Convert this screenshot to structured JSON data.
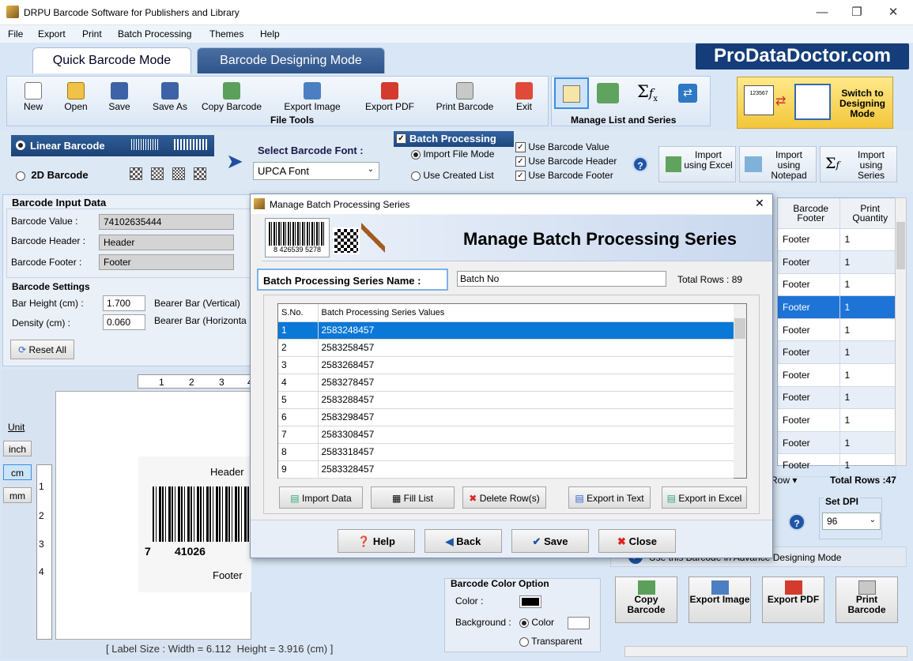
{
  "window": {
    "title": "DRPU Barcode Software for Publishers and Library",
    "min": "—",
    "max": "❐",
    "close": "✕"
  },
  "menu": [
    "File",
    "Export",
    "Print",
    "Batch Processing",
    "Themes",
    "Help"
  ],
  "tabs": {
    "quick": "Quick Barcode Mode",
    "design": "Barcode Designing Mode"
  },
  "brand": "ProDataDoctor.com",
  "tools": {
    "new": "New",
    "open": "Open",
    "save": "Save",
    "save_as": "Save As",
    "copy_barcode": "Copy Barcode",
    "export_image": "Export Image",
    "export_pdf": "Export PDF",
    "print_barcode": "Print Barcode",
    "exit": "Exit",
    "group": "File Tools"
  },
  "manage": {
    "group": "Manage List and Series"
  },
  "switch": {
    "label": "Switch to Designing Mode",
    "sample": "123567"
  },
  "barcode_type": {
    "linear": "Linear Barcode",
    "twod": "2D Barcode"
  },
  "font": {
    "label": "Select Barcode Font :",
    "value": "UPCA Font"
  },
  "batch": {
    "title": "Batch Processing",
    "import_file": "Import File Mode",
    "use_list": "Use Created List",
    "use_value": "Use Barcode Value",
    "use_header": "Use Barcode Header",
    "use_footer": "Use Barcode Footer",
    "help": "?"
  },
  "imports": {
    "excel": "Import using Excel",
    "notepad": "Import using Notepad",
    "series": "Import using Series"
  },
  "input": {
    "title": "Barcode Input Data",
    "value_label": "Barcode Value :",
    "value": "74102635444",
    "header_label": "Barcode Header :",
    "header": "Header",
    "footer_label": "Barcode Footer :",
    "footer": "Footer"
  },
  "settings": {
    "title": "Barcode Settings",
    "bar_height_label": "Bar Height (cm) :",
    "bar_height": "1.700",
    "density_label": "Density (cm) :",
    "density": "0.060",
    "bearer_v": "Bearer Bar (Vertical)",
    "bearer_h": "Bearer Bar (Horizonta",
    "reset": "Reset All"
  },
  "units": {
    "label": "Unit",
    "inch": "inch",
    "cm": "cm",
    "mm": "mm"
  },
  "ruler": [
    "1",
    "2",
    "3",
    "4"
  ],
  "vruler": [
    "1",
    "2",
    "3",
    "4"
  ],
  "preview": {
    "header": "Header",
    "footer": "Footer",
    "num_left": "7",
    "num_mid": "41026"
  },
  "status": "[ Label Size : Width = 6.112  Height = 3.916 (cm) ]",
  "color": {
    "title": "Barcode Color Option",
    "color_label": "Color :",
    "bg_label": "Background :",
    "opt_color": "Color",
    "opt_transparent": "Transparent",
    "bar_color": "#000000"
  },
  "right_table": {
    "col_footer": "Barcode Footer",
    "col_qty": "Print Quantity",
    "rows": [
      [
        "Footer",
        "1"
      ],
      [
        "Footer",
        "1"
      ],
      [
        "Footer",
        "1"
      ],
      [
        "Footer",
        "1"
      ],
      [
        "Footer",
        "1"
      ],
      [
        "Footer",
        "1"
      ],
      [
        "Footer",
        "1"
      ],
      [
        "Footer",
        "1"
      ],
      [
        "Footer",
        "1"
      ],
      [
        "Footer",
        "1"
      ],
      [
        "Footer",
        "1"
      ]
    ],
    "row_dd": "Row ▾",
    "total": "Total Rows :47"
  },
  "dpi": {
    "label": "Set DPI",
    "value": "96",
    "nt": "nt",
    "help": "?"
  },
  "advance": "Use this Barcode in Advance Designing Mode",
  "bottom_buttons": {
    "copy": "Copy Barcode",
    "image": "Export Image",
    "pdf": "Export PDF",
    "print": "Print Barcode"
  },
  "dialog": {
    "title": "Manage Batch Processing Series",
    "banner": "Manage Batch Processing Series",
    "banner_digits": "8 426539 5278",
    "series_label": "Batch Processing Series Name :",
    "series_name": "Batch No",
    "total_rows": "Total Rows : 89",
    "col_sno": "S.No.",
    "col_values": "Batch Processing Series Values",
    "rows": [
      [
        "1",
        "2583248457"
      ],
      [
        "2",
        "2583258457"
      ],
      [
        "3",
        "2583268457"
      ],
      [
        "4",
        "2583278457"
      ],
      [
        "5",
        "2583288457"
      ],
      [
        "6",
        "2583298457"
      ],
      [
        "7",
        "2583308457"
      ],
      [
        "8",
        "2583318457"
      ],
      [
        "9",
        "2583328457"
      ]
    ],
    "import": "Import Data",
    "fill": "Fill List",
    "delete": "Delete Row(s)",
    "export_text": "Export in Text",
    "export_excel": "Export in Excel",
    "help": "Help",
    "back": "Back",
    "save": "Save",
    "close": "Close",
    "x": "✕"
  }
}
